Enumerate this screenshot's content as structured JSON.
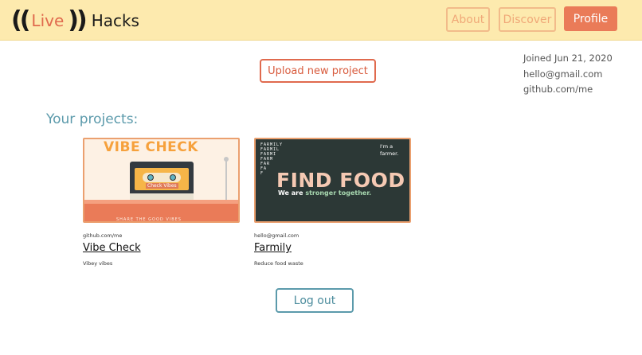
{
  "header": {
    "logo": {
      "paren_left": "((",
      "live": "Live",
      "paren_right": "))",
      "hacks": "Hacks"
    },
    "nav": [
      {
        "label": "About"
      },
      {
        "label": "Discover"
      },
      {
        "label": "Profile"
      }
    ]
  },
  "main": {
    "upload_label": "Upload new project",
    "section_title": "Your projects:",
    "logout_label": "Log out"
  },
  "profile": {
    "joined": "Joined Jun 21, 2020",
    "email": "hello@gmail.com",
    "github": "github.com/me"
  },
  "projects": [
    {
      "author": "github.com/me",
      "title": "Vibe Check",
      "description": "Vibey vibes",
      "thumb": {
        "heading": "VIBE CHECK",
        "tape_label": "Check Vibes",
        "footer": "SHARE THE GOOD VIBES"
      }
    },
    {
      "author": "hello@gmail.com",
      "title": "Farmily",
      "description": "Reduce food waste",
      "thumb": {
        "stack": "FARMILY\nFARMIL\nFARMI\nFARM\nFAR\nFA\nF",
        "im_a_farmer": "I'm a farmer.",
        "headline": "FIND FOOD",
        "tag_prefix": "We are ",
        "tag_highlight": "stronger together."
      }
    }
  ],
  "colors": {
    "navbar_bg": "#fdeaae",
    "accent_orange": "#ea7b58",
    "accent_teal": "#5b9aab"
  }
}
